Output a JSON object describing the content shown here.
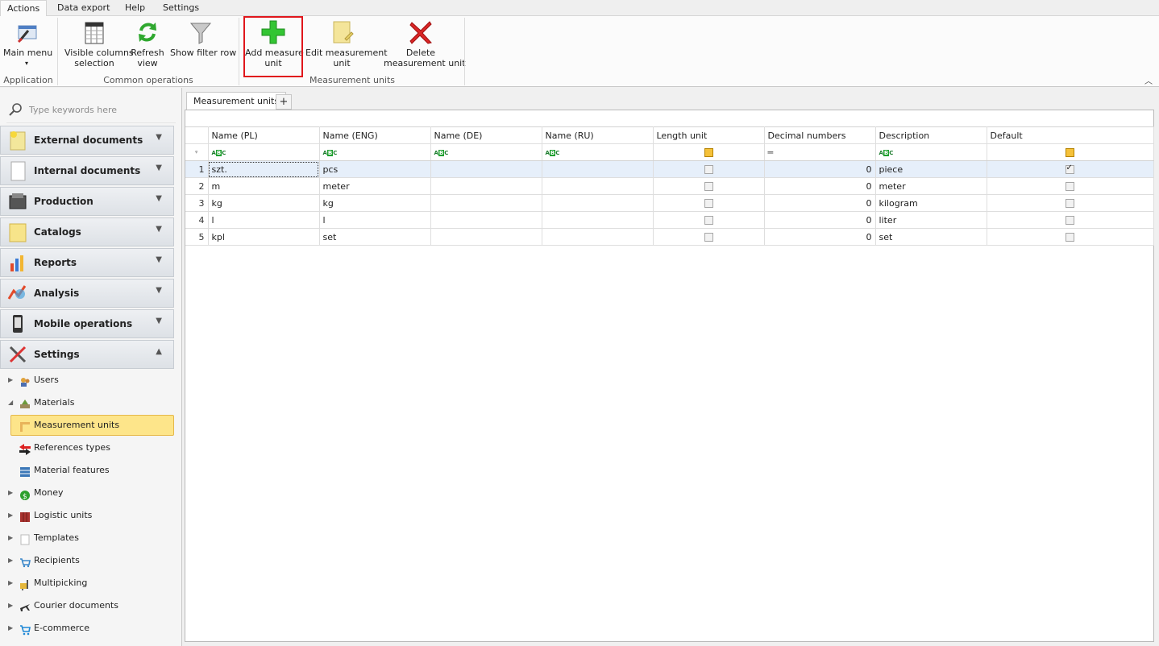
{
  "menu": {
    "tabs": [
      "Actions",
      "Data export",
      "Help",
      "Settings"
    ],
    "active": "Actions"
  },
  "ribbon": {
    "buttons": {
      "main_menu": "Main menu",
      "visible_columns_1": "Visible columns",
      "visible_columns_2": "selection",
      "refresh_1": "Refresh",
      "refresh_2": "view",
      "show_filter_row": "Show filter row",
      "add_measure_1": "Add measure",
      "add_measure_2": "unit",
      "edit_measure_1": "Edit measurement",
      "edit_measure_2": "unit",
      "delete_measure_1": "Delete",
      "delete_measure_2": "measurement unit"
    },
    "groups": {
      "application": "Application",
      "common_operations": "Common operations",
      "measurement_units": "Measurement units"
    }
  },
  "sidebar": {
    "search_placeholder": "Type keywords here",
    "groups": [
      {
        "label": "External documents",
        "icon": "external-documents-icon",
        "expanded": false
      },
      {
        "label": "Internal documents",
        "icon": "internal-documents-icon",
        "expanded": false
      },
      {
        "label": "Production",
        "icon": "production-icon",
        "expanded": false
      },
      {
        "label": "Catalogs",
        "icon": "catalogs-icon",
        "expanded": false
      },
      {
        "label": "Reports",
        "icon": "reports-icon",
        "expanded": false
      },
      {
        "label": "Analysis",
        "icon": "analysis-icon",
        "expanded": false
      },
      {
        "label": "Mobile operations",
        "icon": "mobile-icon",
        "expanded": false
      },
      {
        "label": "Settings",
        "icon": "settings-icon",
        "expanded": true
      }
    ],
    "tree": [
      {
        "label": "Users",
        "icon": "users-icon"
      },
      {
        "label": "Materials",
        "icon": "materials-icon"
      },
      {
        "label": "Measurement units",
        "icon": "ruler-icon",
        "selected": true
      },
      {
        "label": "References types",
        "icon": "references-icon"
      },
      {
        "label": "Material features",
        "icon": "features-icon"
      },
      {
        "label": "Money",
        "icon": "money-icon"
      },
      {
        "label": "Logistic units",
        "icon": "logistic-icon"
      },
      {
        "label": "Templates",
        "icon": "templates-icon"
      },
      {
        "label": "Recipients",
        "icon": "recipients-icon"
      },
      {
        "label": "Multipicking",
        "icon": "multipicking-icon"
      },
      {
        "label": "Courier documents",
        "icon": "courier-icon"
      },
      {
        "label": "E-commerce",
        "icon": "ecommerce-icon"
      }
    ]
  },
  "main": {
    "tab_label": "Measurement units",
    "add_tab": "+",
    "columns": [
      "Name (PL)",
      "Name (ENG)",
      "Name (DE)",
      "Name (RU)",
      "Length unit",
      "Decimal numbers",
      "Description",
      "Default"
    ],
    "rows": [
      {
        "n": "1",
        "pl": "szt.",
        "eng": "pcs",
        "de": "",
        "ru": "",
        "length": false,
        "decimals": "0",
        "desc": "piece",
        "default": true
      },
      {
        "n": "2",
        "pl": "m",
        "eng": "meter",
        "de": "",
        "ru": "",
        "length": false,
        "decimals": "0",
        "desc": "meter",
        "default": false
      },
      {
        "n": "3",
        "pl": "kg",
        "eng": "kg",
        "de": "",
        "ru": "",
        "length": false,
        "decimals": "0",
        "desc": "kilogram",
        "default": false
      },
      {
        "n": "4",
        "pl": "l",
        "eng": "l",
        "de": "",
        "ru": "",
        "length": false,
        "decimals": "0",
        "desc": "liter",
        "default": false
      },
      {
        "n": "5",
        "pl": "kpl",
        "eng": "set",
        "de": "",
        "ru": "",
        "length": false,
        "decimals": "0",
        "desc": "set",
        "default": false
      }
    ]
  },
  "colors": {
    "highlight": "#e0161c",
    "selected_tree": "#fde58a",
    "row_selected": "#e6effa"
  }
}
